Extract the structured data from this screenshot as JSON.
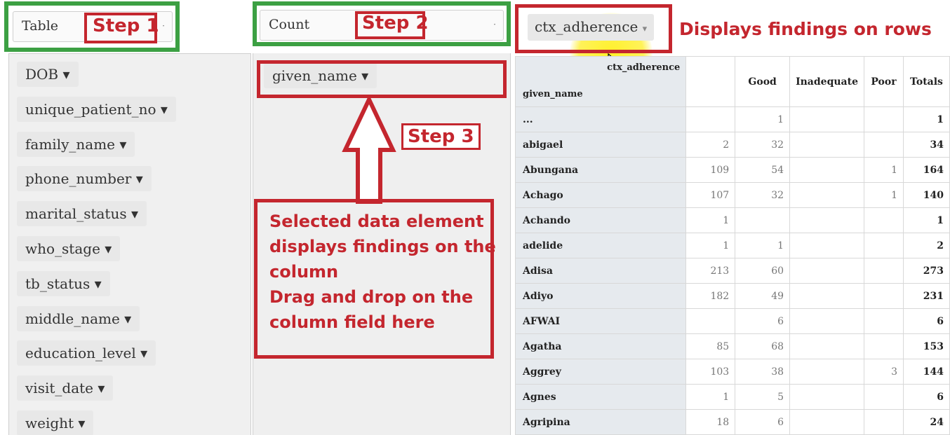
{
  "renderer_select": {
    "label": "Table",
    "caret": "·"
  },
  "aggregator_select": {
    "label": "Count",
    "caret": "·"
  },
  "row_select": {
    "label": "ctx_adherence",
    "caret": "▾"
  },
  "steps": {
    "step1": "Step 1",
    "step2": "Step 2",
    "step3": "Step 3"
  },
  "annotations": {
    "rows_note": "Displays findings on rows",
    "column_note_lines": [
      "Selected data element",
      "displays findings on the",
      "column",
      "Drag and drop on the",
      "column field here"
    ]
  },
  "column_field": {
    "label": "given_name ▾"
  },
  "attributes": [
    "DOB ▾",
    "unique_patient_no ▾",
    "family_name ▾",
    "phone_number ▾",
    "marital_status ▾",
    "who_stage ▾",
    "tb_status ▾",
    "middle_name ▾",
    "education_level ▾",
    "visit_date ▾",
    "weight ▾"
  ],
  "pivot": {
    "col_attr_label": "ctx_adherence",
    "row_attr_label": "given_name",
    "columns": [
      "",
      "Good",
      "Inadequate",
      "Poor",
      "Totals"
    ],
    "rows": [
      {
        "name": "...",
        "values": [
          "",
          "1",
          "",
          "",
          "1"
        ]
      },
      {
        "name": "abigael",
        "values": [
          "2",
          "32",
          "",
          "",
          "34"
        ]
      },
      {
        "name": "Abungana",
        "values": [
          "109",
          "54",
          "",
          "1",
          "164"
        ]
      },
      {
        "name": "Achago",
        "values": [
          "107",
          "32",
          "",
          "1",
          "140"
        ]
      },
      {
        "name": "Achando",
        "values": [
          "1",
          "",
          "",
          "",
          "1"
        ]
      },
      {
        "name": "adelide",
        "values": [
          "1",
          "1",
          "",
          "",
          "2"
        ]
      },
      {
        "name": "Adisa",
        "values": [
          "213",
          "60",
          "",
          "",
          "273"
        ]
      },
      {
        "name": "Adiyo",
        "values": [
          "182",
          "49",
          "",
          "",
          "231"
        ]
      },
      {
        "name": "AFWAI",
        "values": [
          "",
          "6",
          "",
          "",
          "6"
        ]
      },
      {
        "name": "Agatha",
        "values": [
          "85",
          "68",
          "",
          "",
          "153"
        ]
      },
      {
        "name": "Aggrey",
        "values": [
          "103",
          "38",
          "",
          "3",
          "144"
        ]
      },
      {
        "name": "Agnes",
        "values": [
          "1",
          "5",
          "",
          "",
          "6"
        ]
      },
      {
        "name": "Agripina",
        "values": [
          "18",
          "6",
          "",
          "",
          "24"
        ]
      }
    ]
  },
  "colors": {
    "annotation_red": "#c4262e",
    "annotation_green": "#3ca043",
    "highlight": "#fff01e"
  }
}
